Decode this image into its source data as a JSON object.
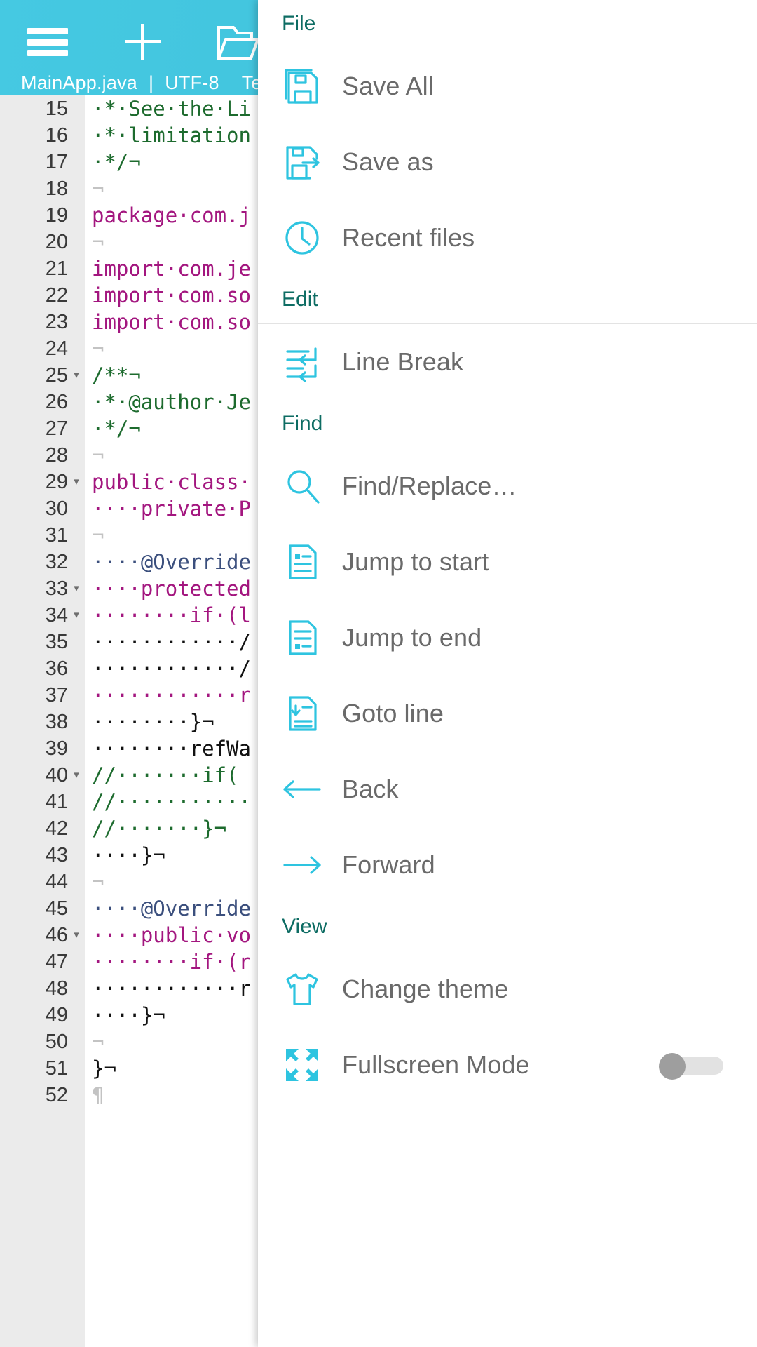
{
  "toolbar": {
    "menu_icon": "hamburger-icon",
    "new_icon": "plus-icon",
    "open_icon": "folder-open-icon",
    "status_file": "MainApp.java",
    "status_sep": "|",
    "status_encoding": "UTF-8",
    "status_mode": "Text"
  },
  "editor": {
    "lines": [
      {
        "num": "15",
        "fold": "",
        "text": "·*·See·the·Li",
        "cls": "c-cmt"
      },
      {
        "num": "16",
        "fold": "",
        "text": "·*·limitation",
        "cls": "c-cmt"
      },
      {
        "num": "17",
        "fold": "",
        "text": "·*/¬",
        "cls": "c-cmt"
      },
      {
        "num": "18",
        "fold": "",
        "text": "¬",
        "cls": "c-eol"
      },
      {
        "num": "19",
        "fold": "",
        "text": "package·com.j",
        "cls": "c-kw"
      },
      {
        "num": "20",
        "fold": "",
        "text": "¬",
        "cls": "c-eol"
      },
      {
        "num": "21",
        "fold": "",
        "text": "import·com.je",
        "cls": "c-kw"
      },
      {
        "num": "22",
        "fold": "",
        "text": "import·com.so",
        "cls": "c-kw"
      },
      {
        "num": "23",
        "fold": "",
        "text": "import·com.so",
        "cls": "c-kw"
      },
      {
        "num": "24",
        "fold": "",
        "text": "¬",
        "cls": "c-eol"
      },
      {
        "num": "25",
        "fold": "▾",
        "text": "/**¬",
        "cls": "c-cmt"
      },
      {
        "num": "26",
        "fold": "",
        "text": "·*·@author·Je",
        "cls": "c-cmt"
      },
      {
        "num": "27",
        "fold": "",
        "text": "·*/¬",
        "cls": "c-cmt"
      },
      {
        "num": "28",
        "fold": "",
        "text": "¬",
        "cls": "c-eol"
      },
      {
        "num": "29",
        "fold": "▾",
        "text": "public·class·",
        "cls": "c-kw"
      },
      {
        "num": "30",
        "fold": "",
        "text": "····private·P",
        "cls": "c-kw"
      },
      {
        "num": "31",
        "fold": "",
        "text": "¬",
        "cls": "c-eol"
      },
      {
        "num": "32",
        "fold": "",
        "text": "····@Override",
        "cls": "c-ann"
      },
      {
        "num": "33",
        "fold": "▾",
        "text": "····protected",
        "cls": "c-kw"
      },
      {
        "num": "34",
        "fold": "▾",
        "text": "········if·(l",
        "cls": "c-kw"
      },
      {
        "num": "35",
        "fold": "",
        "text": "············/",
        "cls": "c-plain"
      },
      {
        "num": "36",
        "fold": "",
        "text": "············/",
        "cls": "c-plain"
      },
      {
        "num": "37",
        "fold": "",
        "text": "············r",
        "cls": "c-kw"
      },
      {
        "num": "38",
        "fold": "",
        "text": "········}¬",
        "cls": "c-plain"
      },
      {
        "num": "39",
        "fold": "",
        "text": "········refWa",
        "cls": "c-plain"
      },
      {
        "num": "40",
        "fold": "▾",
        "text": "//·······if(",
        "cls": "c-cmt"
      },
      {
        "num": "41",
        "fold": "",
        "text": "//···········",
        "cls": "c-cmt"
      },
      {
        "num": "42",
        "fold": "",
        "text": "//·······}¬",
        "cls": "c-cmt"
      },
      {
        "num": "43",
        "fold": "",
        "text": "····}¬",
        "cls": "c-plain"
      },
      {
        "num": "44",
        "fold": "",
        "text": "¬",
        "cls": "c-eol"
      },
      {
        "num": "45",
        "fold": "",
        "text": "····@Override",
        "cls": "c-ann"
      },
      {
        "num": "46",
        "fold": "▾",
        "text": "····public·vo",
        "cls": "c-kw"
      },
      {
        "num": "47",
        "fold": "",
        "text": "········if·(r",
        "cls": "c-kw"
      },
      {
        "num": "48",
        "fold": "",
        "text": "············r",
        "cls": "c-plain"
      },
      {
        "num": "49",
        "fold": "",
        "text": "····}¬",
        "cls": "c-plain"
      },
      {
        "num": "50",
        "fold": "",
        "text": "¬",
        "cls": "c-eol"
      },
      {
        "num": "51",
        "fold": "",
        "text": "}¬",
        "cls": "c-plain"
      },
      {
        "num": "52",
        "fold": "",
        "text": "¶",
        "cls": "c-eol"
      }
    ]
  },
  "menu": {
    "sections": [
      {
        "title": "File",
        "items": [
          {
            "label": "Save All",
            "icon": "save-all-icon"
          },
          {
            "label": "Save as",
            "icon": "save-as-icon"
          },
          {
            "label": "Recent files",
            "icon": "clock-icon"
          }
        ]
      },
      {
        "title": "Edit",
        "items": [
          {
            "label": "Line Break",
            "icon": "line-break-icon"
          }
        ]
      },
      {
        "title": "Find",
        "items": [
          {
            "label": "Find/Replace…",
            "icon": "search-icon"
          },
          {
            "label": "Jump to start",
            "icon": "document-top-icon"
          },
          {
            "label": "Jump to end",
            "icon": "document-bottom-icon"
          },
          {
            "label": "Goto line",
            "icon": "goto-line-icon"
          },
          {
            "label": "Back",
            "icon": "arrow-left-icon"
          },
          {
            "label": "Forward",
            "icon": "arrow-right-icon"
          }
        ]
      },
      {
        "title": "View",
        "items": [
          {
            "label": "Change theme",
            "icon": "tshirt-icon"
          },
          {
            "label": "Fullscreen Mode",
            "icon": "fullscreen-icon",
            "toggle": "off"
          }
        ]
      }
    ]
  },
  "colors": {
    "accent": "#44c8e0",
    "icon": "#2ec4e0",
    "section_title": "#0d6c63",
    "menu_label": "#6a6a6a",
    "gutter": "#ebebeb"
  }
}
